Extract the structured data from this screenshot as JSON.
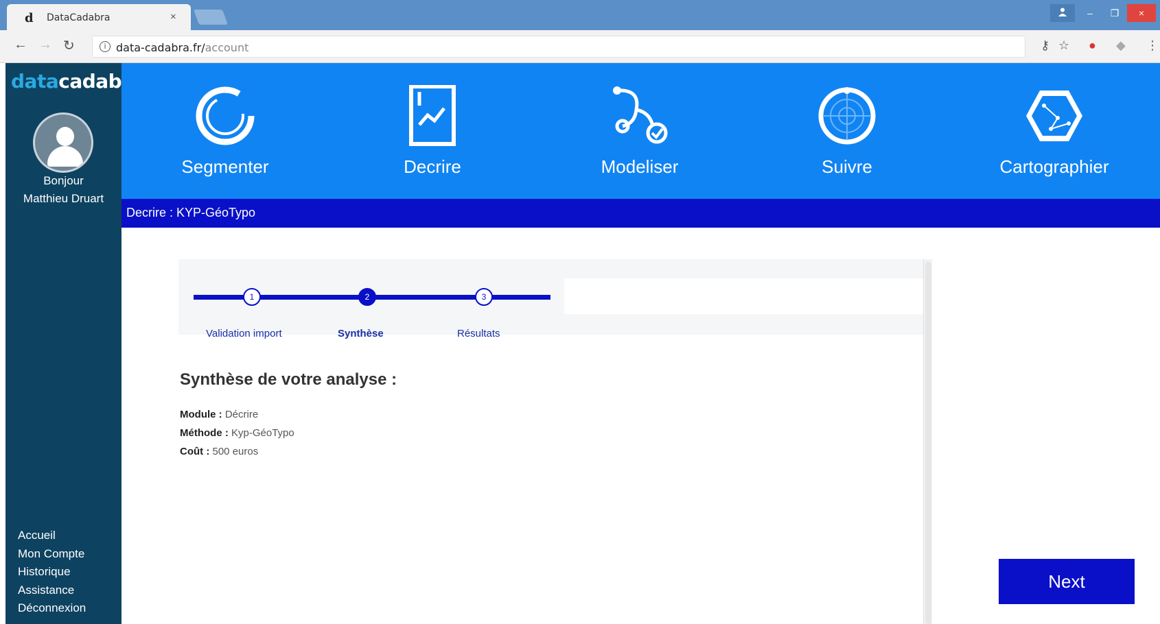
{
  "browser": {
    "tab_title": "DataCadabra",
    "tab_close": "×",
    "url_host": "data-cadabra.fr/",
    "url_path": "account",
    "window_user_icon": "user-icon",
    "window_min": "–",
    "window_max": "❐",
    "window_close": "×"
  },
  "sidebar": {
    "logo_part1": "data",
    "logo_part2": "cadabra",
    "greeting": "Bonjour",
    "user_name": "Matthieu Druart",
    "menu": [
      {
        "label": "Accueil"
      },
      {
        "label": "Mon Compte"
      },
      {
        "label": "Historique"
      },
      {
        "label": "Assistance"
      },
      {
        "label": "Déconnexion"
      }
    ]
  },
  "modules": [
    {
      "label": "Segmenter",
      "icon": "segment-ring-icon"
    },
    {
      "label": "Decrire",
      "icon": "chart-document-icon"
    },
    {
      "label": "Modeliser",
      "icon": "model-path-icon"
    },
    {
      "label": "Suivre",
      "icon": "radar-icon"
    },
    {
      "label": "Cartographier",
      "icon": "map-hexagon-icon"
    }
  ],
  "breadcrumb": "Decrire : KYP-GéoTypo",
  "stepper": {
    "steps": [
      {
        "number": "1",
        "label": "Validation import"
      },
      {
        "number": "2",
        "label": "Synthèse"
      },
      {
        "number": "3",
        "label": "Résultats"
      }
    ],
    "active_step": 2
  },
  "synthesis": {
    "title": "Synthèse de votre analyse :",
    "module_label": "Module :",
    "module_value": "Décrire",
    "method_label": "Méthode :",
    "method_value": "Kyp-GéoTypo",
    "cost_label": "Coût :",
    "cost_value": "500 euros"
  },
  "next_button": "Next",
  "colors": {
    "sidebar": "#0e4261",
    "modules_bar": "#1184f3",
    "primary": "#0a10c8",
    "titlebar": "#5a8fc7"
  }
}
